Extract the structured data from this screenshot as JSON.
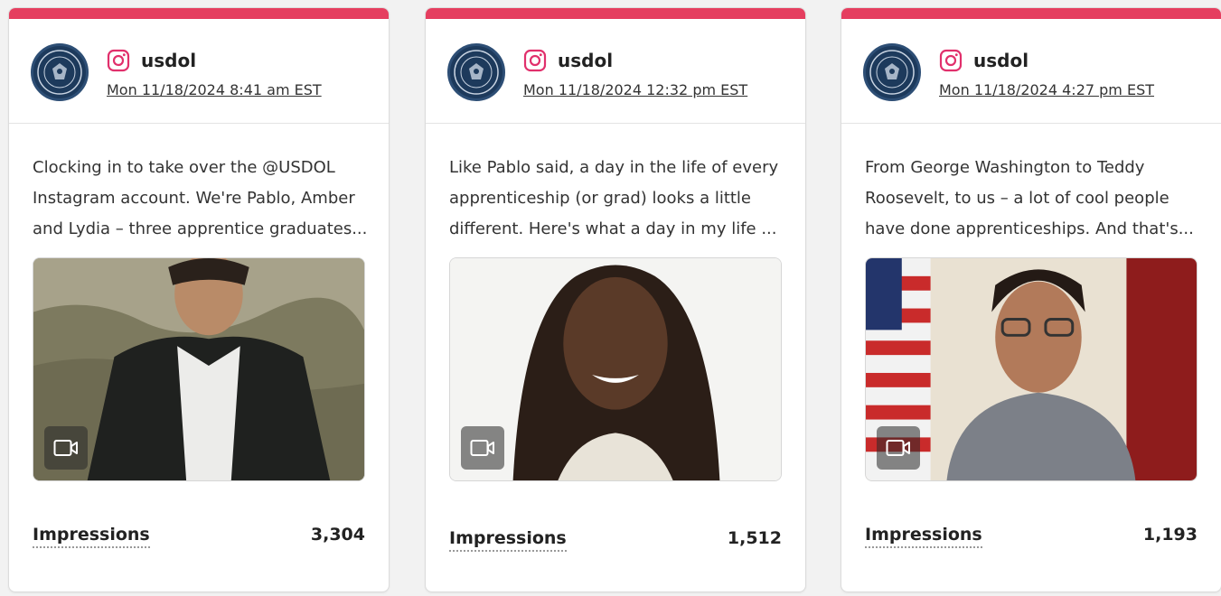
{
  "colors": {
    "accent": "#e53e5f",
    "instagram": "#e1306c",
    "avatar_bg": "#1d3a5c"
  },
  "posts": [
    {
      "platform_icon": "instagram-icon",
      "handle": "usdol",
      "timestamp": "Mon 11/18/2024 8:41 am EST",
      "caption": "Clocking in to take over the @USDOL Instagram account. We're Pablo, Amber and Lydia – three apprentice graduates...",
      "media_type": "video-icon",
      "metric_label": "Impressions",
      "metric_value": "3,304"
    },
    {
      "platform_icon": "instagram-icon",
      "handle": "usdol",
      "timestamp": "Mon 11/18/2024 12:32 pm EST",
      "caption": "Like Pablo said, a day in the life of every apprenticeship (or grad) looks a little different. Here's what a day in my life ...",
      "media_type": "video-icon",
      "metric_label": "Impressions",
      "metric_value": "1,512"
    },
    {
      "platform_icon": "instagram-icon",
      "handle": "usdol",
      "timestamp": "Mon 11/18/2024 4:27 pm EST",
      "caption": "From George Washington to Teddy Roosevelt, to us – a lot of cool people have done apprenticeships. And that's...",
      "media_type": "video-icon",
      "metric_label": "Impressions",
      "metric_value": "1,193"
    }
  ]
}
